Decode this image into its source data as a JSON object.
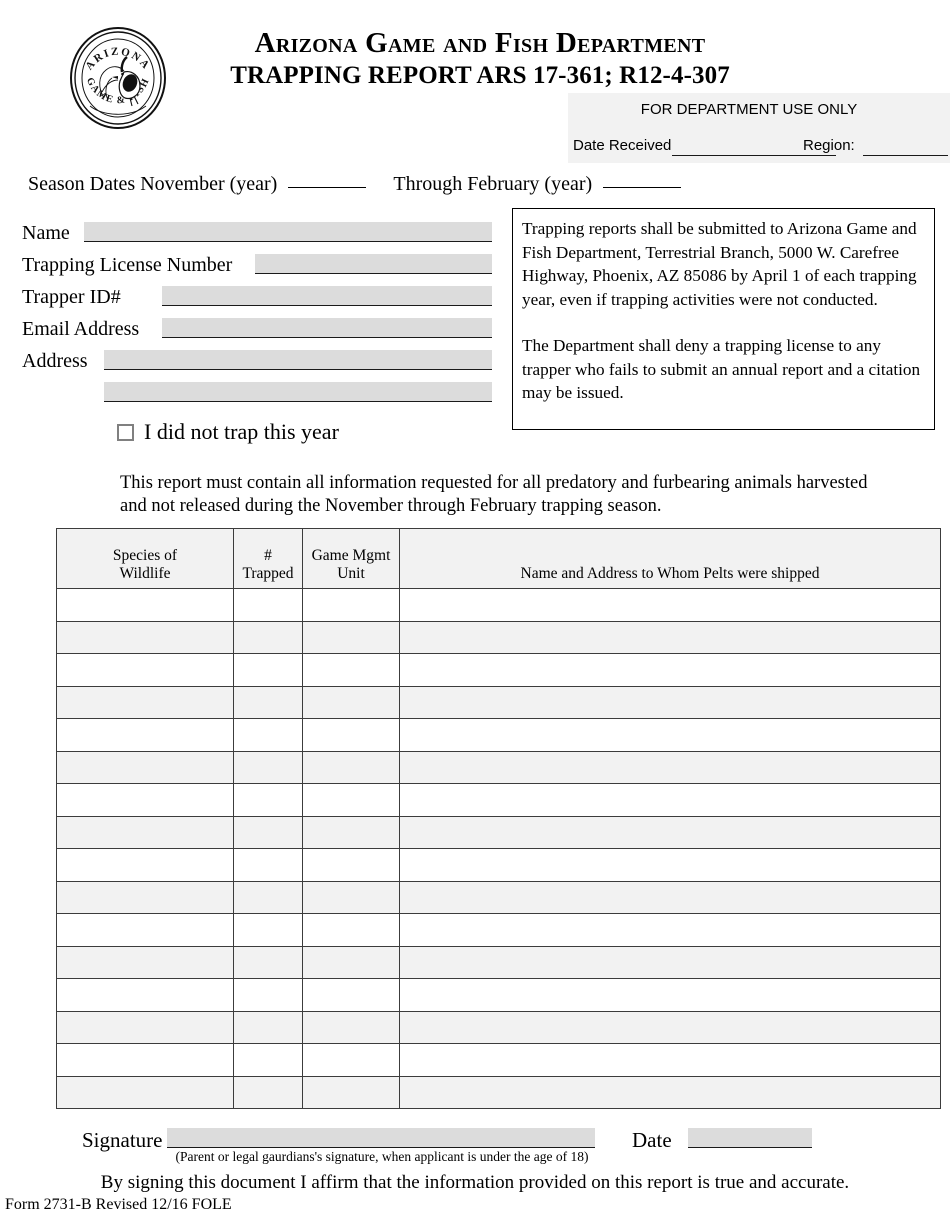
{
  "header": {
    "title_line_1": "Arizona Game and Fish Department",
    "title_line_2": "TRAPPING REPORT ARS 17-361; R12-4-307",
    "seal_text_top": "ARIZONA",
    "seal_text_bottom": "GAME & FISH"
  },
  "dept_use": {
    "title": "FOR DEPARTMENT USE ONLY",
    "date_received_label": "Date Received",
    "date_received_value": "",
    "region_label": "Region:",
    "region_value": ""
  },
  "season": {
    "prefix": "Season Dates November (year)",
    "november_year": "",
    "through": "Through February (year)",
    "february_year": ""
  },
  "applicant": {
    "fields": [
      {
        "label": "Name",
        "value": "",
        "placeholder": ""
      },
      {
        "label": "Trapping License Number",
        "value": "",
        "placeholder": ""
      },
      {
        "label": "Trapper ID#",
        "value": "",
        "placeholder": ""
      },
      {
        "label": "Email Address",
        "value": "",
        "placeholder": ""
      },
      {
        "label": "Address",
        "value": "",
        "placeholder": ""
      },
      {
        "label": "",
        "value": "",
        "placeholder": ""
      }
    ]
  },
  "instructions": {
    "paragraph_1": "Trapping reports shall be submitted to Arizona Game and Fish Department, Terrestrial Branch, 5000 W. Carefree Highway, Phoenix, AZ 85086 by April 1 of each trapping year, even if trapping activities were not conducted.",
    "paragraph_2": "The Department shall deny a trapping license to any trapper who fails to submit an annual report and a citation may be issued."
  },
  "no_trap": {
    "label": "I did not trap this year",
    "checked": false
  },
  "report_instruction": "This report must contain all information requested for all predatory and furbearing animals harvested and not released during the November through February trapping season.",
  "table": {
    "columns": [
      {
        "line_1": "Species of",
        "line_2": "Wildlife"
      },
      {
        "line_1": "#",
        "line_2": "Trapped"
      },
      {
        "line_1": "Game Mgmt",
        "line_2": "Unit"
      },
      {
        "line_1": "",
        "line_2": "Name and Address to Whom Pelts were shipped"
      }
    ],
    "row_count": 16,
    "rows": [
      {
        "species": "",
        "trapped": "",
        "unit": "",
        "shipped": ""
      },
      {
        "species": "",
        "trapped": "",
        "unit": "",
        "shipped": ""
      },
      {
        "species": "",
        "trapped": "",
        "unit": "",
        "shipped": ""
      },
      {
        "species": "",
        "trapped": "",
        "unit": "",
        "shipped": ""
      },
      {
        "species": "",
        "trapped": "",
        "unit": "",
        "shipped": ""
      },
      {
        "species": "",
        "trapped": "",
        "unit": "",
        "shipped": ""
      },
      {
        "species": "",
        "trapped": "",
        "unit": "",
        "shipped": ""
      },
      {
        "species": "",
        "trapped": "",
        "unit": "",
        "shipped": ""
      },
      {
        "species": "",
        "trapped": "",
        "unit": "",
        "shipped": ""
      },
      {
        "species": "",
        "trapped": "",
        "unit": "",
        "shipped": ""
      },
      {
        "species": "",
        "trapped": "",
        "unit": "",
        "shipped": ""
      },
      {
        "species": "",
        "trapped": "",
        "unit": "",
        "shipped": ""
      },
      {
        "species": "",
        "trapped": "",
        "unit": "",
        "shipped": ""
      },
      {
        "species": "",
        "trapped": "",
        "unit": "",
        "shipped": ""
      },
      {
        "species": "",
        "trapped": "",
        "unit": "",
        "shipped": ""
      },
      {
        "species": "",
        "trapped": "",
        "unit": "",
        "shipped": ""
      }
    ]
  },
  "signature": {
    "label": "Signature",
    "value": "",
    "subnote": "(Parent or legal gaurdians's signature, when applicant is under the age of 18)",
    "date_label": "Date",
    "date_value": "",
    "affirmation": "By signing this document I  affirm that the information provided on this report is true and accurate."
  },
  "footer": {
    "form_number": "Form 2731-B   Revised 12/16 FOLE"
  },
  "colors": {
    "field_fill": "#dcdcdc",
    "panel_gray": "#f2f2f2",
    "rule": "#1a1a1a"
  }
}
